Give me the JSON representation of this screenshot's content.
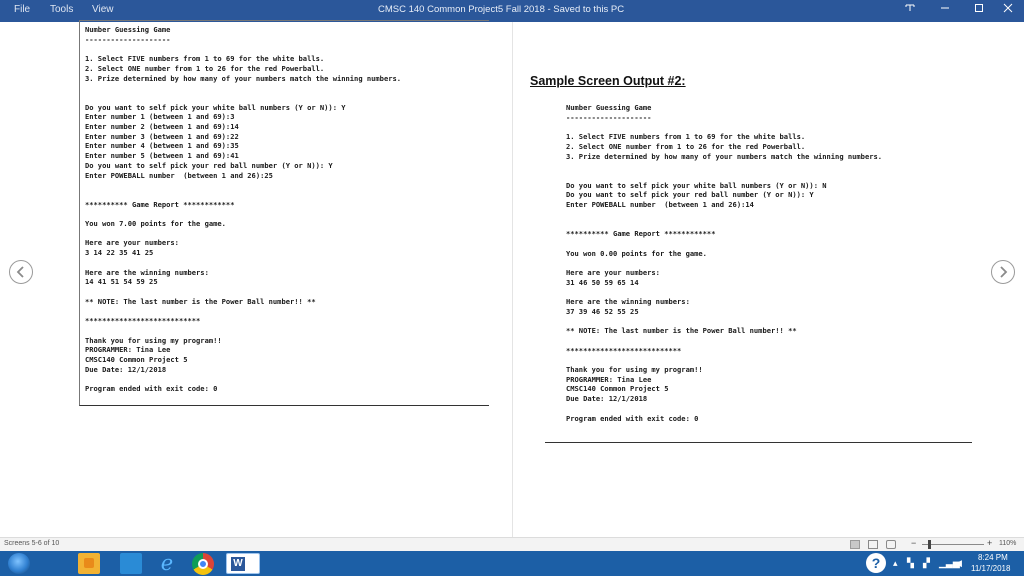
{
  "titlebar": {
    "menus": [
      "File",
      "Tools",
      "View"
    ],
    "document_title": "CMSC 140 Common Project5 Fall 2018  -  Saved to this PC"
  },
  "left_console": [
    "Number Guessing Game",
    "--------------------",
    "",
    "1. Select FIVE numbers from 1 to 69 for the white balls.",
    "2. Select ONE number from 1 to 26 for the red Powerball.",
    "3. Prize determined by how many of your numbers match the winning numbers.",
    "",
    "",
    "Do you want to self pick your white ball numbers (Y or N)): Y",
    "Enter number 1 (between 1 and 69):3",
    "Enter number 2 (between 1 and 69):14",
    "Enter number 3 (between 1 and 69):22",
    "Enter number 4 (between 1 and 69):35",
    "Enter number 5 (between 1 and 69):41",
    "Do you want to self pick your red ball number (Y or N)): Y",
    "Enter POWEBALL number  (between 1 and 26):25",
    "",
    "",
    "********** Game Report ************",
    "",
    "You won 7.00 points for the game.",
    "",
    "Here are your numbers:",
    "3 14 22 35 41 25",
    "",
    "Here are the winning numbers:",
    "14 41 51 54 59 25",
    "",
    "** NOTE: The last number is the Power Ball number!! **",
    "",
    "***************************",
    "",
    "Thank you for using my program!!",
    "PROGRAMMER: Tina Lee",
    "CMSC140 Common Project 5",
    "Due Date: 12/1/2018",
    "",
    "Program ended with exit code: 0"
  ],
  "sample_heading": "Sample Screen Output #2:",
  "right_console": [
    "Number Guessing Game",
    "--------------------",
    "",
    "1. Select FIVE numbers from 1 to 69 for the white balls.",
    "2. Select ONE number from 1 to 26 for the red Powerball.",
    "3. Prize determined by how many of your numbers match the winning numbers.",
    "",
    "",
    "Do you want to self pick your white ball numbers (Y or N)): N",
    "Do you want to self pick your red ball number (Y or N)): Y",
    "Enter POWEBALL number  (between 1 and 26):14",
    "",
    "",
    "********** Game Report ************",
    "",
    "You won 0.00 points for the game.",
    "",
    "Here are your numbers:",
    "31 46 50 59 65 14",
    "",
    "Here are the winning numbers:",
    "37 39 46 52 55 25",
    "",
    "** NOTE: The last number is the Power Ball number!! **",
    "",
    "***************************",
    "",
    "Thank you for using my program!!",
    "PROGRAMMER: Tina Lee",
    "CMSC140 Common Project 5",
    "Due Date: 12/1/2018",
    "",
    "Program ended with exit code: 0"
  ],
  "statusbar": {
    "screens": "Screens 5-6 of 10",
    "zoom_minus": "−",
    "zoom_plus": "+",
    "zoom": "110%",
    "zoom_fraction": 0.1
  },
  "taskbar": {
    "word_label": "W",
    "help_label": "?",
    "time": "8:24 PM",
    "date": "11/17/2018"
  },
  "colors": {
    "titlebar": "#2b579a",
    "taskbar": "#1c5fa6"
  },
  "icons": [
    "restore-mode-icon",
    "minimize-icon",
    "maximize-icon",
    "close-icon",
    "chevron-left-icon",
    "chevron-right-icon",
    "windows-start-icon",
    "file-explorer-icon",
    "internet-explorer-icon",
    "chrome-icon",
    "word-icon",
    "help-icon",
    "network-icon",
    "volume-icon"
  ]
}
